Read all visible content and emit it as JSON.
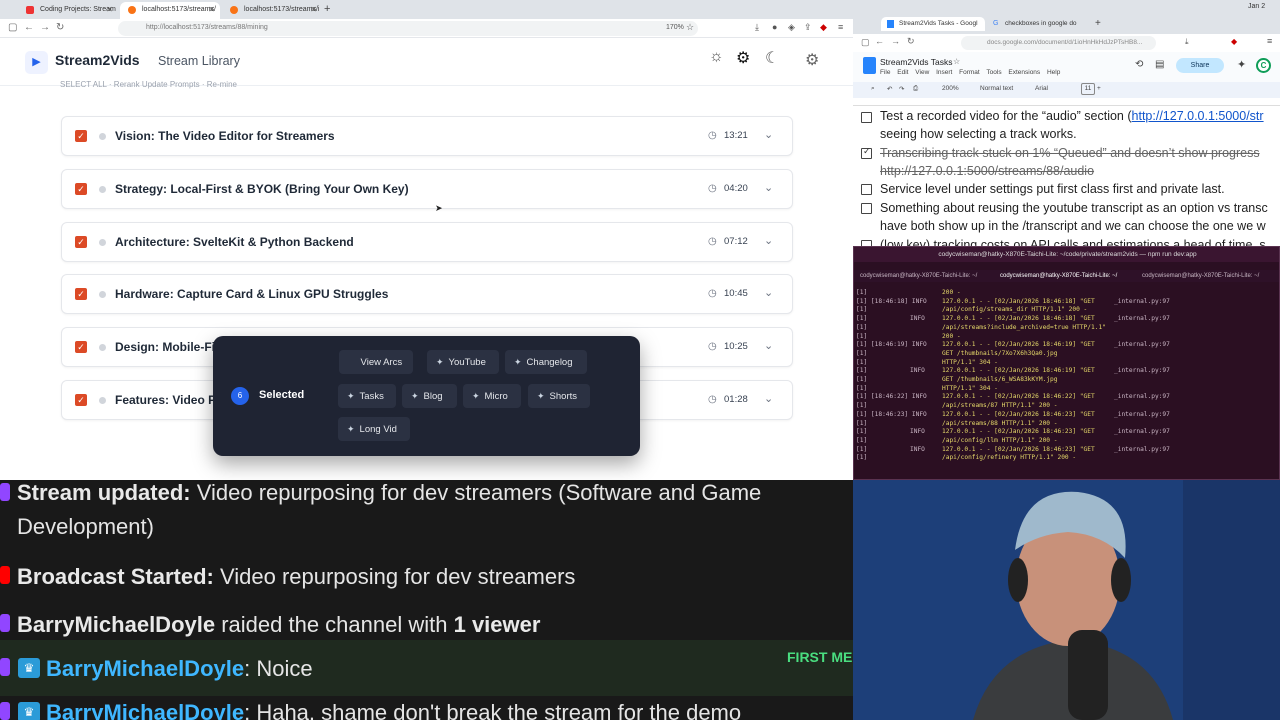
{
  "left_browser": {
    "tabs": [
      {
        "label": "Coding Projects: Stream"
      },
      {
        "label": "localhost:5173/streams/"
      },
      {
        "label": "localhost:5173/streams/i"
      }
    ],
    "url": "http://localhost:5173/streams/88/mining",
    "zoom": "170%",
    "app": {
      "brand": "Stream2Vids",
      "nav_library": "Stream Library",
      "hidden_row": "SELECT ALL    ·    Rerank                                                                                      Update Prompts    ·    Re-mine"
    },
    "arcs": [
      {
        "title": "Vision: The Video Editor for Streamers",
        "duration": "13:21"
      },
      {
        "title": "Strategy: Local-First & BYOK (Bring Your Own Key)",
        "duration": "04:20"
      },
      {
        "title": "Architecture: SvelteKit & Python Backend",
        "duration": "07:12"
      },
      {
        "title": "Hardware: Capture Card & Linux GPU Struggles",
        "duration": "10:45"
      },
      {
        "title": "Design: Mobile-Fi",
        "duration": "10:25"
      },
      {
        "title": "Features: Video P",
        "duration": "01:28"
      }
    ],
    "selection": {
      "count": "6",
      "label": "Selected",
      "buttons": {
        "view_arcs": "View Arcs",
        "youtube": "YouTube",
        "changelog": "Changelog",
        "tasks": "Tasks",
        "blog": "Blog",
        "micro": "Micro",
        "shorts": "Shorts",
        "long_vid": "Long Vid"
      }
    }
  },
  "chat": {
    "lines": [
      {
        "user": "Stream updated:",
        "text": " Video repurposing for dev streamers (Software and Game",
        "cont": "Development)"
      },
      {
        "user": "Broadcast Started:",
        "text": " Video repurposing for dev streamers"
      },
      {
        "user": "BarryMichaelDoyle",
        "text": " raided the channel with ",
        "bold2": "1 viewer"
      },
      {
        "user": "BarryMichaelDoyle",
        "text": ": Noice"
      },
      {
        "user": "BarryMichaelDoyle",
        "text": ": Haha, shame don't break the stream for the demo"
      }
    ],
    "first_me": "FIRST ME"
  },
  "right_browser": {
    "tabs": [
      {
        "label": "Stream2Vids Tasks - Googl"
      },
      {
        "label": "checkboxes in google do"
      }
    ],
    "date": "Jan 2",
    "url": "docs.google.com/document/d/1ioHnHkHdJzPTsHB8...",
    "doc_title": "Stream2Vids Tasks",
    "menu": "File Edit View Insert Format Tools Extensions Help",
    "share": "Share",
    "avatar": "C",
    "zoom": "200%",
    "style": "Normal text",
    "font": "Arial",
    "font_size": "11",
    "items": [
      {
        "text": "Test a recorded video for the “audio” section (",
        "link": "http://127.0.0.1:5000/str",
        "cont": "seeing how selecting a track works.",
        "checked": false
      },
      {
        "text": "Transcribing track stuck on 1% “Queued” and doesn’t show progress",
        "cont": "http://127.0.0.1:5000/streams/88/audio",
        "checked": true
      },
      {
        "text": "Service level under settings put first class first and private last.",
        "checked": false
      },
      {
        "text": "Something about reusing the youtube transcript as an option vs transc",
        "cont": "have both show up in the /transcript and we can choose the one we w",
        "checked": false
      },
      {
        "text": "(low key) tracking costs on API calls and estimations a head of time, s",
        "checked": false
      }
    ]
  },
  "terminal": {
    "title": "codycwiseman@hatky-X870E-Taichi-Lite: ~/code/private/stream2vids — npm run dev:app",
    "tabs": [
      "codycwiseman@hatky-X870E-Taichi-Lite: ~/",
      "codycwiseman@hatky-X870E-Taichi-Lite: ~/",
      "codycwiseman@hatky-X870E-Taichi-Lite: ~/"
    ],
    "lines": [
      {
        "pre": "[1]",
        "time": "",
        "lvl": "",
        "msg": "200 -",
        "src": ""
      },
      {
        "pre": "[1] [18:46:18] INFO",
        "time": "",
        "lvl": "",
        "msg": "127.0.0.1 - - [02/Jan/2026 18:46:18] \"GET",
        "src": "_internal.py:97"
      },
      {
        "pre": "[1]",
        "time": "",
        "lvl": "",
        "msg": "/api/config/streams_dir HTTP/1.1\" 200 -",
        "src": ""
      },
      {
        "pre": "[1]",
        "time": "",
        "lvl": "INFO",
        "msg": "127.0.0.1 - - [02/Jan/2026 18:46:18] \"GET",
        "src": "_internal.py:97"
      },
      {
        "pre": "[1]",
        "time": "",
        "lvl": "",
        "msg": "/api/streams?include_archived=true HTTP/1.1\"",
        "src": ""
      },
      {
        "pre": "[1]",
        "time": "",
        "lvl": "",
        "msg": "200 -",
        "src": ""
      },
      {
        "pre": "[1] [18:46:19] INFO",
        "time": "",
        "lvl": "",
        "msg": "127.0.0.1 - - [02/Jan/2026 18:46:19] \"GET",
        "src": "_internal.py:97"
      },
      {
        "pre": "[1]",
        "time": "",
        "lvl": "",
        "msg": "\u001b[36mGET /thumbnails/7Xo7X6h3Qa0.jpg",
        "src": ""
      },
      {
        "pre": "[1]",
        "time": "",
        "lvl": "",
        "msg": "HTTP/1.1\u001b[0m\" 304 -",
        "src": ""
      },
      {
        "pre": "[1]",
        "time": "",
        "lvl": "INFO",
        "msg": "127.0.0.1 - - [02/Jan/2026 18:46:19] \"GET",
        "src": "_internal.py:97"
      },
      {
        "pre": "[1]",
        "time": "",
        "lvl": "",
        "msg": "\u001b[36mGET /thumbnails/6_WSA83kKYM.jpg",
        "src": ""
      },
      {
        "pre": "[1]",
        "time": "",
        "lvl": "",
        "msg": "HTTP/1.1\u001b[0m\" 304 -",
        "src": ""
      },
      {
        "pre": "[1] [18:46:22] INFO",
        "time": "",
        "lvl": "",
        "msg": "127.0.0.1 - - [02/Jan/2026 18:46:22] \"GET",
        "src": "_internal.py:97"
      },
      {
        "pre": "[1]",
        "time": "",
        "lvl": "",
        "msg": "/api/streams/87 HTTP/1.1\" 200 -",
        "src": ""
      },
      {
        "pre": "[1] [18:46:23] INFO",
        "time": "",
        "lvl": "",
        "msg": "127.0.0.1 - - [02/Jan/2026 18:46:23] \"GET",
        "src": "_internal.py:97"
      },
      {
        "pre": "[1]",
        "time": "",
        "lvl": "",
        "msg": "/api/streams/88 HTTP/1.1\" 200 -",
        "src": ""
      },
      {
        "pre": "[1]",
        "time": "",
        "lvl": "INFO",
        "msg": "127.0.0.1 - - [02/Jan/2026 18:46:23] \"GET",
        "src": "_internal.py:97"
      },
      {
        "pre": "[1]",
        "time": "",
        "lvl": "",
        "msg": "/api/config/llm HTTP/1.1\" 200 -",
        "src": ""
      },
      {
        "pre": "[1]",
        "time": "",
        "lvl": "INFO",
        "msg": "127.0.0.1 - - [02/Jan/2026 18:46:23] \"GET",
        "src": "_internal.py:97"
      },
      {
        "pre": "[1]",
        "time": "",
        "lvl": "",
        "msg": "/api/config/refinery HTTP/1.1\" 200 -",
        "src": ""
      }
    ]
  },
  "colors": {
    "accent": "#dc4a26",
    "brand_blue": "#2563eb",
    "popup_bg": "#1f2433",
    "terminal_bg": "#2b0f22",
    "chat_bg": "#191919"
  }
}
